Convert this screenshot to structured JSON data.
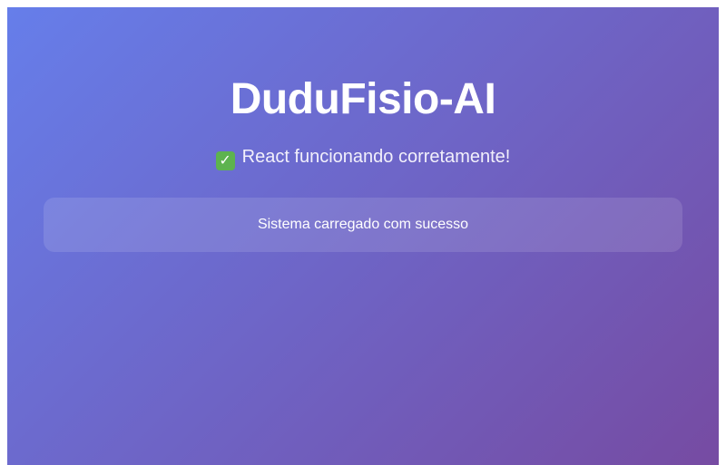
{
  "app": {
    "title": "DuduFisio-AI",
    "status_icon": "check-mark-icon",
    "status_message": "React funcionando corretamente!",
    "card_message": "Sistema carregado com sucesso"
  },
  "colors": {
    "gradient_start": "#667eea",
    "gradient_end": "#764ba2",
    "check_green": "#5db34f"
  }
}
